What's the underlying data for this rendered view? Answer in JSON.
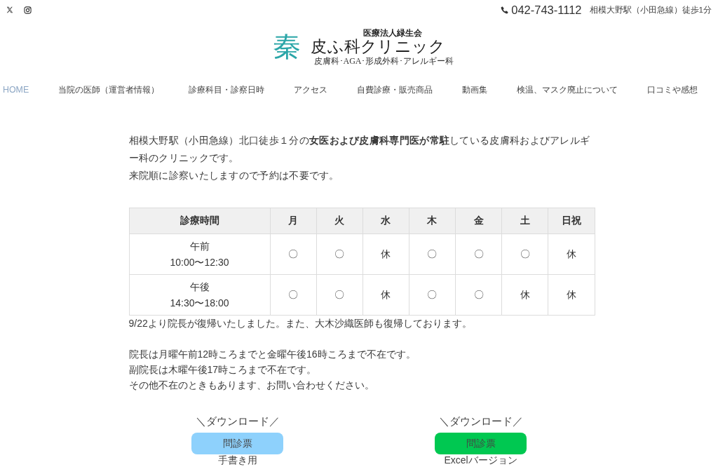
{
  "top_bar": {
    "phone": "042-743-1112",
    "access": "相模大野駅（小田急線）徒歩1分"
  },
  "logo": {
    "mark": "秦",
    "corporation": "医療法人緑生会",
    "name": "皮ふ科クリニック",
    "departments": "皮膚科･AGA･形成外科･アレルギー科"
  },
  "nav": [
    {
      "label": "HOME",
      "selected": true
    },
    {
      "label": "当院の医師（運営者情報）",
      "selected": false
    },
    {
      "label": "診療科目・診察日時",
      "selected": false
    },
    {
      "label": "アクセス",
      "selected": false
    },
    {
      "label": "自費診療・販売商品",
      "selected": false
    },
    {
      "label": "動画集",
      "selected": false
    },
    {
      "label": "検温、マスク廃止について",
      "selected": false
    },
    {
      "label": "口コミや感想",
      "selected": false
    }
  ],
  "intro": [
    "相模大野駅（小田急線）北口徒歩１分の**女医および皮膚科専門医が常駐**している皮膚科およびアレルギー科のクリニックです。",
    "来院順に診察いたしますので予約は不要です。"
  ],
  "schedule": {
    "columns": [
      "診療時間",
      "月",
      "火",
      "水",
      "木",
      "金",
      "土",
      "日祝"
    ],
    "rows": [
      {
        "cells": [
          "午前\n10:00〜12:30",
          "〇",
          "〇",
          "休",
          "〇",
          "〇",
          "〇",
          "休"
        ]
      },
      {
        "cells": [
          "午後\n14:30〜18:00",
          "〇",
          "〇",
          "休",
          "〇",
          "〇",
          "休",
          "休"
        ]
      }
    ]
  },
  "notes": [
    {
      "lines": [
        "9/22より院長が復帰いたしました。また、大木沙織医師も復帰しております。"
      ]
    },
    {
      "lines": [
        "院長は月曜午前12時ころまでと金曜午後16時ころまで不在です。",
        "副院長は木曜午後17時ころまで不在です。",
        "その他不在のときもあります、お問い合わせください。"
      ]
    }
  ],
  "downloads": [
    {
      "caption": "＼ダウンロード／",
      "button": "問診票",
      "color": "#8ed1fc",
      "note": "手書き用"
    },
    {
      "caption": "＼ダウンロード／",
      "button": "問診票",
      "color": "#00c851",
      "note": "Excelバージョン"
    }
  ]
}
